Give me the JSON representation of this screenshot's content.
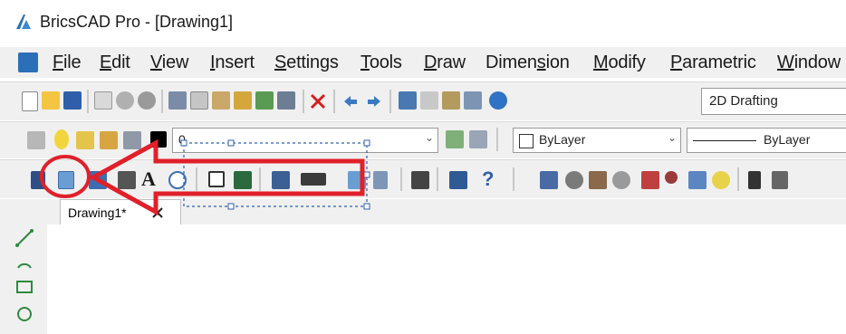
{
  "window": {
    "title": "BricsCAD Pro - [Drawing1]"
  },
  "menu": {
    "items": [
      {
        "accel": "F",
        "rest": "ile"
      },
      {
        "accel": "E",
        "rest": "dit"
      },
      {
        "accel": "V",
        "rest": "iew"
      },
      {
        "accel": "I",
        "rest": "nsert"
      },
      {
        "accel": "S",
        "rest": "ettings"
      },
      {
        "accel": "T",
        "rest": "ools"
      },
      {
        "accel": "D",
        "rest": "raw"
      },
      {
        "pre": "Dimen",
        "accel": "s",
        "rest": "ion"
      },
      {
        "accel": "M",
        "rest": "odify"
      },
      {
        "accel": "P",
        "rest": "arametric"
      },
      {
        "accel": "W",
        "rest": "indow"
      }
    ]
  },
  "toolbar": {
    "workspace": "2D Drafting",
    "layer_value": "0",
    "color_value": "ByLayer",
    "linetype_value": "ByLayer"
  },
  "tabs": {
    "drawing_tab": "Drawing1*"
  },
  "colors": {
    "annotation": "#e0202a",
    "accent": "#2b6fb8"
  }
}
